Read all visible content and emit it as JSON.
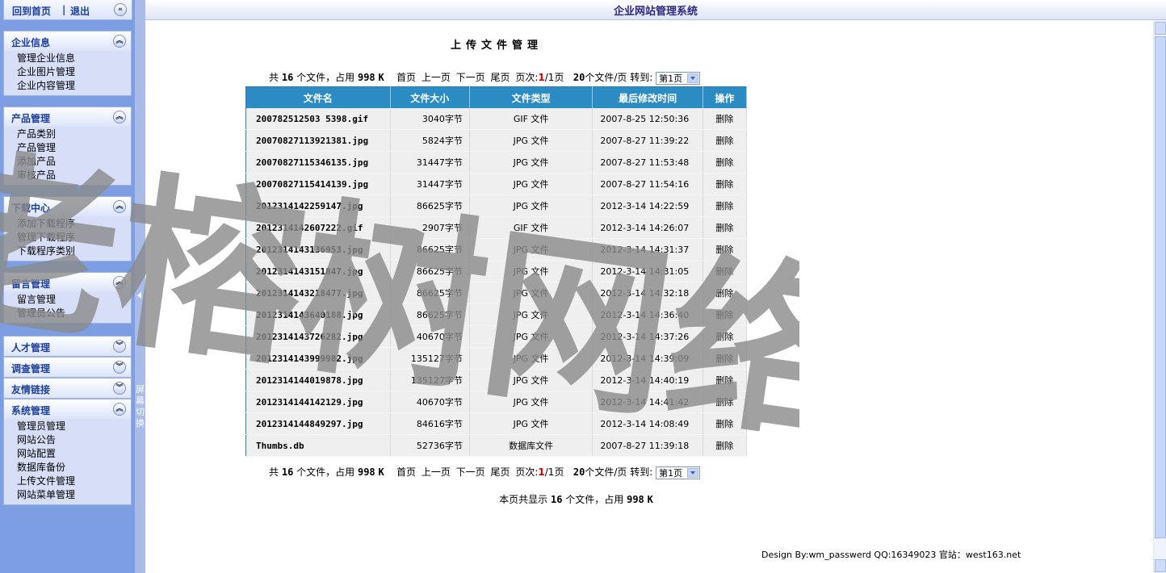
{
  "app": {
    "title": "企业网站管理系统"
  },
  "topnav": {
    "home": "回到首页",
    "sep": "|",
    "logout": "退出"
  },
  "sidebar": {
    "groups": [
      {
        "title": "企业信息",
        "items": [
          "管理企业信息",
          "企业图片管理",
          "企业内容管理"
        ]
      },
      {
        "title": "产品管理",
        "items": [
          "产品类别",
          "产品管理",
          "添加产品",
          "审核产品"
        ]
      },
      {
        "title": "下载中心",
        "items": [
          "添加下载程序",
          "管理下载程序",
          "下载程序类别"
        ]
      },
      {
        "title": "留言管理",
        "items": [
          "留言管理",
          "管理员公告"
        ]
      },
      {
        "title": "人才管理",
        "items": []
      },
      {
        "title": "调查管理",
        "items": []
      },
      {
        "title": "友情链接",
        "items": []
      },
      {
        "title": "系统管理",
        "items": [
          "管理员管理",
          "网站公告",
          "网站配置",
          "数据库备份",
          "上传文件管理",
          "网站菜单管理"
        ]
      }
    ],
    "splitter_label": "屏幕切换"
  },
  "main": {
    "title": "上传文件管理",
    "pager": {
      "total_prefix": "共",
      "file_count": "16",
      "mid": "个文件，占用",
      "size": "998",
      "unit": "K",
      "first": "首页",
      "prev": "上一页",
      "next": "下一页",
      "last": "尾页",
      "page_label": "页次:",
      "current": "1",
      "page_total": "/1页",
      "per_page_num": "20",
      "per_page": "个文件/页",
      "goto": "转到:",
      "select_value": "第1页"
    },
    "table": {
      "headers": [
        "文件名",
        "文件大小",
        "文件类型",
        "最后修改时间",
        "操作"
      ],
      "rows": [
        [
          "200782512503 5398.gif",
          "3040字节",
          "GIF 文件",
          "2007-8-25 12:50:36",
          "删除"
        ],
        [
          "20070827113921381.jpg",
          "5824字节",
          "JPG 文件",
          "2007-8-27 11:39:22",
          "删除"
        ],
        [
          "20070827115346135.jpg",
          "31447字节",
          "JPG 文件",
          "2007-8-27 11:53:48",
          "删除"
        ],
        [
          "20070827115414139.jpg",
          "31447字节",
          "JPG 文件",
          "2007-8-27 11:54:16",
          "删除"
        ],
        [
          "2012314142259147.jpg",
          "86625字节",
          "JPG 文件",
          "2012-3-14 14:22:59",
          "删除"
        ],
        [
          "2012314142607222.gif",
          "2907字节",
          "GIF 文件",
          "2012-3-14 14:26:07",
          "删除"
        ],
        [
          "2012314143136953.jpg",
          "86625字节",
          "JPG 文件",
          "2012-3-14 14:31:37",
          "删除"
        ],
        [
          "2012314143151847.jpg",
          "86625字节",
          "JPG 文件",
          "2012-3-14 14:31:05",
          "删除"
        ],
        [
          "2012314143218477.jpg",
          "86625字节",
          "JPG 文件",
          "2012-3-14 14:32:18",
          "删除"
        ],
        [
          "2012314143640188.jpg",
          "86625字节",
          "JPG 文件",
          "2012-3-14 14:36:40",
          "删除"
        ],
        [
          "2012314143726282.jpg",
          "40670字节",
          "JPG 文件",
          "2012-3-14 14:37:26",
          "删除"
        ],
        [
          "2012314143999982.jpg",
          "135127字节",
          "JPG 文件",
          "2012-3-14 14:39:09",
          "删除"
        ],
        [
          "2012314144019878.jpg",
          "135127字节",
          "JPG 文件",
          "2012-3-14 14:40:19",
          "删除"
        ],
        [
          "2012314144142129.jpg",
          "40670字节",
          "JPG 文件",
          "2012-3-14 14:41:42",
          "删除"
        ],
        [
          "2012314144849297.jpg",
          "84616字节",
          "JPG 文件",
          "2012-3-14 14:08:49",
          "删除"
        ],
        [
          "Thumbs.db",
          "52736字节",
          "数据库文件",
          "2007-8-27 11:39:18",
          "删除"
        ]
      ]
    },
    "summary": {
      "prefix": "本页共显示",
      "count": "16",
      "mid": "个文件，占用",
      "size": "998",
      "unit": "K"
    }
  },
  "footer": {
    "text": "Design By:wm_passwerd QQ:16349023 官站：west163.net"
  },
  "watermark": {
    "text": "老榕树网络"
  }
}
